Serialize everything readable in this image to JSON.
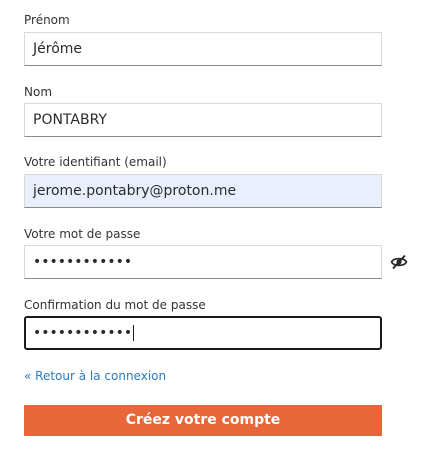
{
  "form": {
    "first_name": {
      "label": "Prénom",
      "value": "Jérôme"
    },
    "last_name": {
      "label": "Nom",
      "value": "PONTABRY"
    },
    "email": {
      "label": "Votre identifiant (email)",
      "value": "jerome.pontabry@proton.me",
      "autofilled": true
    },
    "password": {
      "label": "Votre mot de passe",
      "masked_value": "••••••••••••",
      "toggle_icon": "eye-slash-icon"
    },
    "password_confirm": {
      "label": "Confirmation du mot de passe",
      "masked_value": "••••••••••••",
      "focused": true
    },
    "back_link": "« Retour à la connexion",
    "submit_label": "Créez votre compte"
  },
  "colors": {
    "accent_button": "#e8663a",
    "link": "#2a7bc0",
    "autofill_bg": "#e8f0fe",
    "text": "#333333"
  }
}
